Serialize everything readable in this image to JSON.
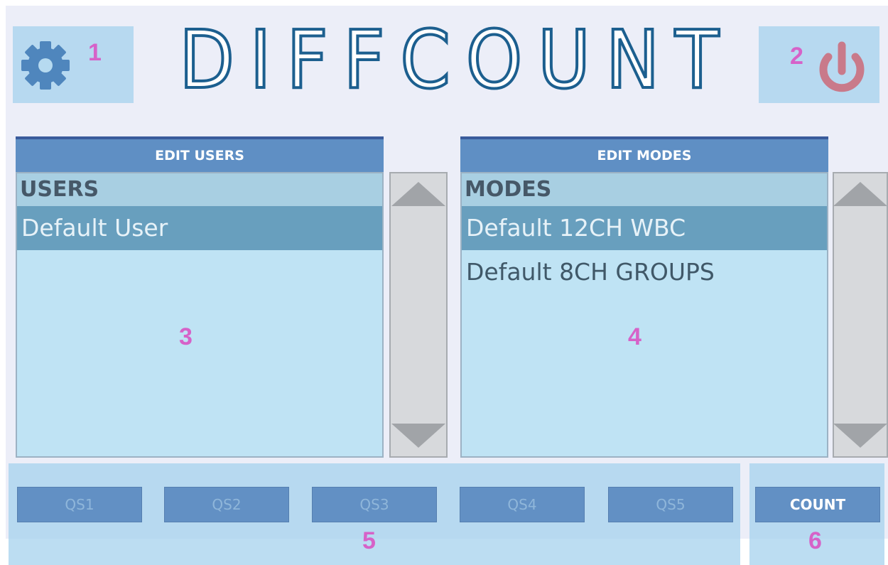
{
  "app": {
    "title": "DIFFCOUNT"
  },
  "markers": {
    "m1": "1",
    "m2": "2",
    "m3": "3",
    "m4": "4",
    "m5": "5",
    "m6": "6"
  },
  "users_panel": {
    "header": "EDIT USERS",
    "list_title": "USERS",
    "items": [
      "Default User"
    ],
    "selected_index": 0
  },
  "modes_panel": {
    "header": "EDIT MODES",
    "list_title": "MODES",
    "items": [
      "Default 12CH WBC",
      "Default 8CH GROUPS"
    ],
    "selected_index": 0
  },
  "quick_select": {
    "buttons": [
      "QS1",
      "QS2",
      "QS3",
      "QS4",
      "QS5"
    ]
  },
  "count_button": {
    "label": "COUNT"
  },
  "icons": {
    "settings": "gear-icon",
    "power": "power-icon"
  },
  "colors": {
    "background": "#eceef8",
    "title_outline": "#1c5f8f",
    "header": "#5f8fc4",
    "list_bg": "#bfe3f4",
    "selected_row": "#689fbe",
    "gear": "#4f86bd",
    "power": "#c97a8a",
    "marker": "#d662c8"
  }
}
